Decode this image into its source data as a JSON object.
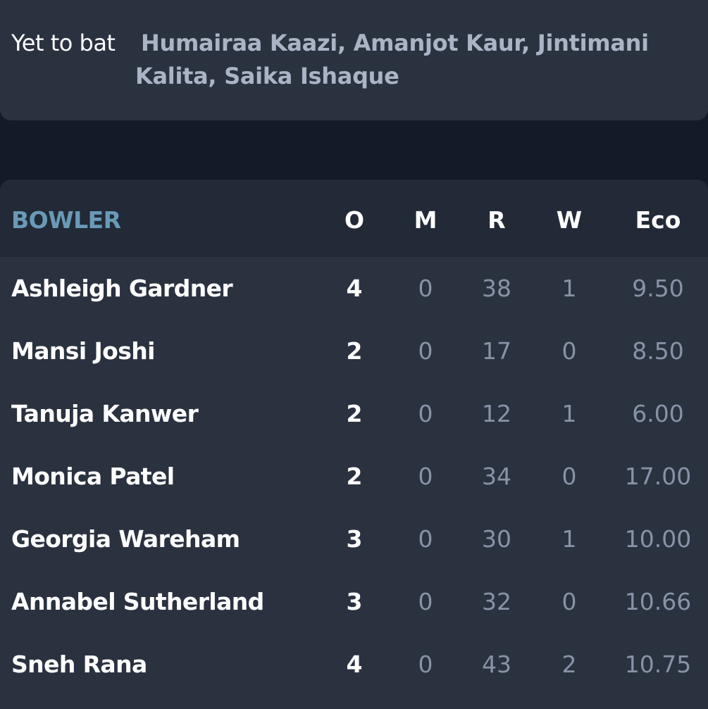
{
  "yet_to_bat": {
    "label": "Yet to bat",
    "names": "Humairaa Kaazi, Amanjot Kaur, Jintimani Kalita, Saika Ishaque"
  },
  "bowling": {
    "headers": {
      "bowler": "BOWLER",
      "overs": "O",
      "maidens": "M",
      "runs": "R",
      "wickets": "W",
      "economy": "Eco"
    },
    "rows": [
      {
        "name": "Ashleigh Gardner",
        "o": "4",
        "m": "0",
        "r": "38",
        "w": "1",
        "eco": "9.50"
      },
      {
        "name": "Mansi Joshi",
        "o": "2",
        "m": "0",
        "r": "17",
        "w": "0",
        "eco": "8.50"
      },
      {
        "name": "Tanuja Kanwer",
        "o": "2",
        "m": "0",
        "r": "12",
        "w": "1",
        "eco": "6.00"
      },
      {
        "name": "Monica Patel",
        "o": "2",
        "m": "0",
        "r": "34",
        "w": "0",
        "eco": "17.00"
      },
      {
        "name": "Georgia Wareham",
        "o": "3",
        "m": "0",
        "r": "30",
        "w": "1",
        "eco": "10.00"
      },
      {
        "name": "Annabel Sutherland",
        "o": "3",
        "m": "0",
        "r": "32",
        "w": "0",
        "eco": "10.66"
      },
      {
        "name": "Sneh Rana",
        "o": "4",
        "m": "0",
        "r": "43",
        "w": "2",
        "eco": "10.75"
      }
    ]
  },
  "colors": {
    "background": "#131a28",
    "card": "#2a3240",
    "header_row": "#222a37",
    "bowler_header": "#6a9ab6",
    "muted_text": "#8793a6",
    "yet_names": "#aab4c5"
  }
}
